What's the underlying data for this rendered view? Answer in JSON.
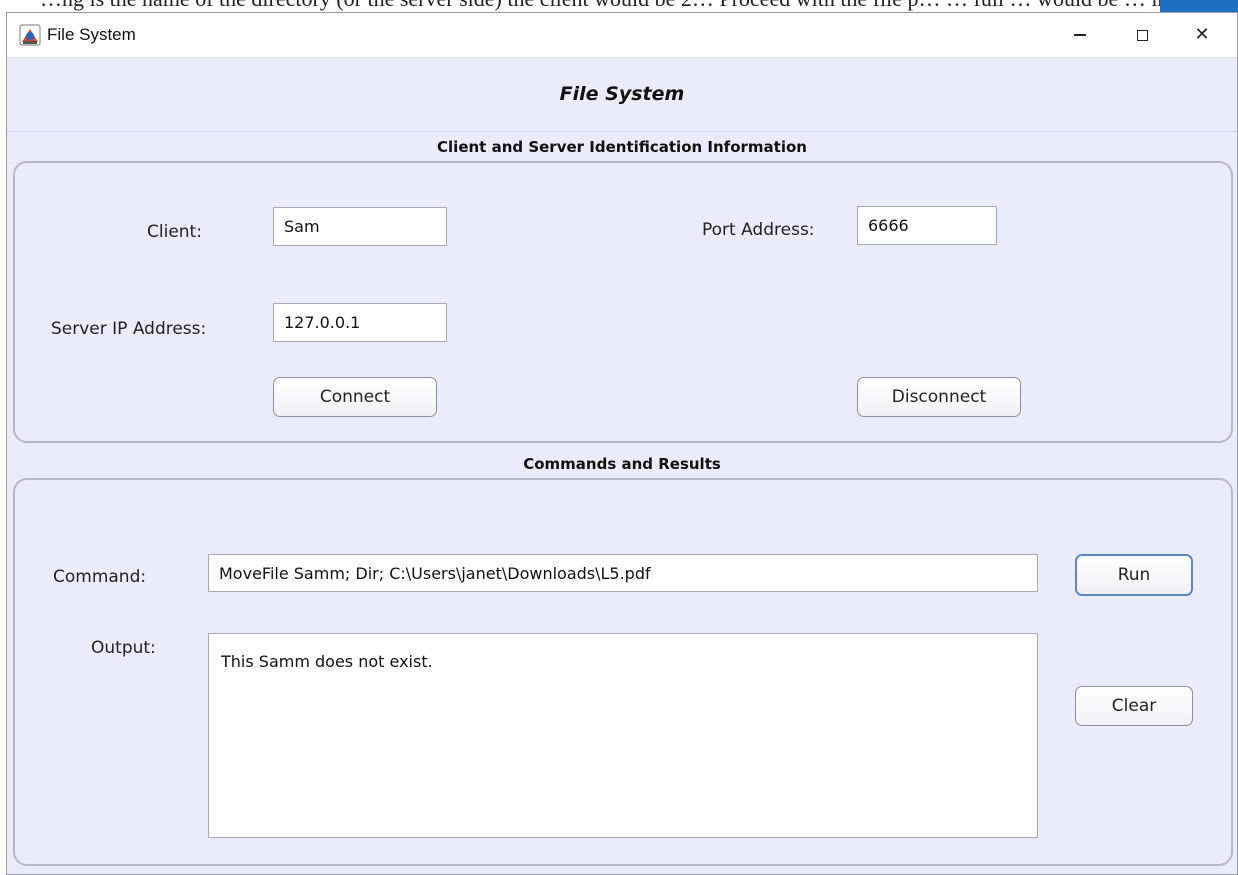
{
  "background": {
    "snippet": "…ng is the name of the directory (or the server side) the client would be 2… Proceed with the file p… … full … would be … in to …"
  },
  "window": {
    "title": "File System",
    "controls": {
      "minimize": "–",
      "maximize": "☐",
      "close": "✕"
    },
    "icon": "java-app-icon"
  },
  "header": {
    "title": "File System"
  },
  "identification": {
    "section_title": "Client and Server Identification Information",
    "client_label": "Client:",
    "client_value": "Sam",
    "port_label": "Port Address:",
    "port_value": "6666",
    "server_ip_label": "Server IP Address:",
    "server_ip_value": "127.0.0.1",
    "connect_label": "Connect",
    "disconnect_label": "Disconnect"
  },
  "commands": {
    "section_title": "Commands and Results",
    "command_label": "Command:",
    "command_value": "MoveFile Samm; Dir; C:\\Users\\janet\\Downloads\\L5.pdf",
    "output_label": "Output:",
    "output_value": "This Samm does not exist.",
    "run_label": "Run",
    "clear_label": "Clear"
  },
  "colors": {
    "window_bg": "#ecebfb",
    "panel_border": "#b9b9c6",
    "focus_border": "#5a88c4"
  }
}
